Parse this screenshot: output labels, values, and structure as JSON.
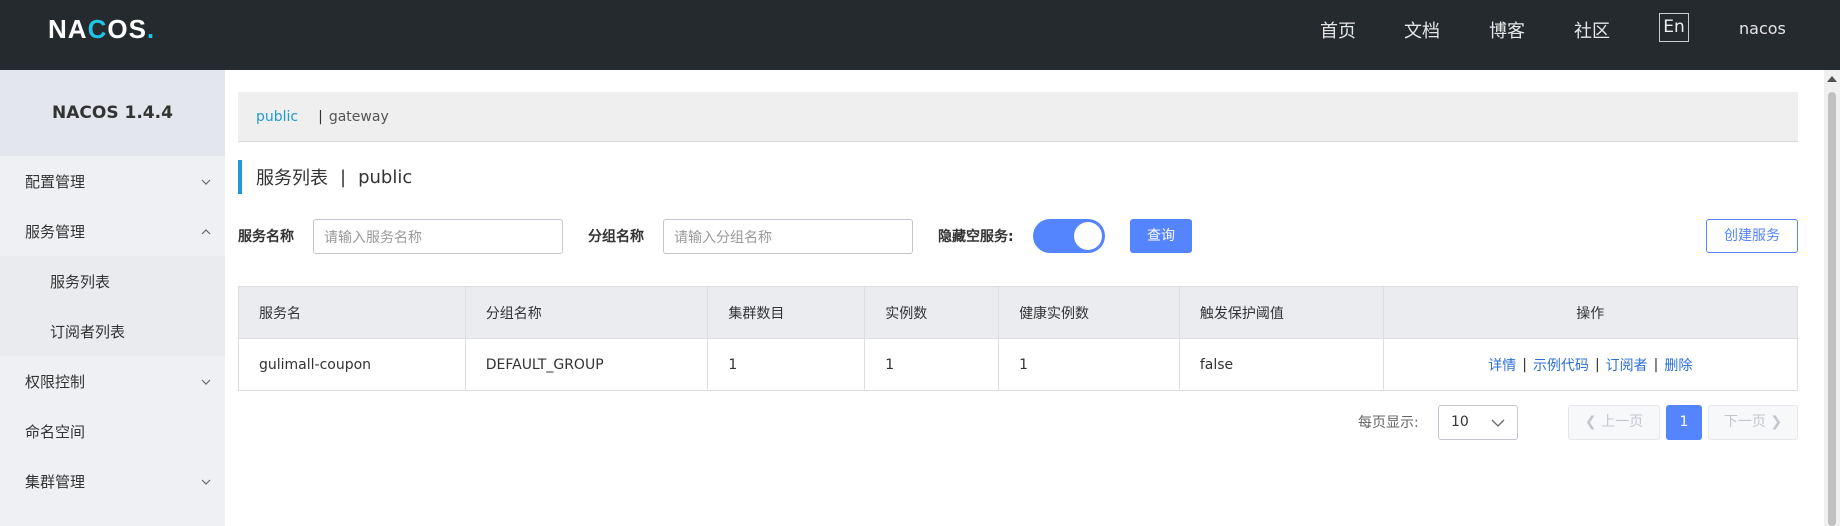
{
  "header": {
    "logo_left": "NA",
    "logo_mid": "C",
    "logo_right": "OS",
    "logo_dot": ".",
    "nav": [
      "首页",
      "文档",
      "博客",
      "社区"
    ],
    "lang_button": "En",
    "user": "nacos"
  },
  "sidebar": {
    "title": "NACOS 1.4.4",
    "items": [
      {
        "label": "配置管理",
        "chevron": "chevron-down"
      },
      {
        "label": "服务管理",
        "chevron": "chevron-up"
      },
      {
        "label": "服务列表",
        "sub": true
      },
      {
        "label": "订阅者列表",
        "sub": true
      },
      {
        "label": "权限控制",
        "chevron": "chevron-down"
      },
      {
        "label": "命名空间"
      },
      {
        "label": "集群管理",
        "chevron": "chevron-down"
      }
    ]
  },
  "namespace_bar": {
    "active": "public",
    "separator": "|",
    "other": "gateway"
  },
  "page": {
    "title": "服务列表",
    "separator": "|",
    "namespace": "public"
  },
  "filters": {
    "service_name_label": "服务名称",
    "service_name_placeholder": "请输入服务名称",
    "group_name_label": "分组名称",
    "group_name_placeholder": "请输入分组名称",
    "hide_empty_label": "隐藏空服务:",
    "hide_empty_on": true,
    "query_button": "查询",
    "create_button": "创建服务"
  },
  "table": {
    "columns": [
      "服务名",
      "分组名称",
      "集群数目",
      "实例数",
      "健康实例数",
      "触发保护阈值",
      "操作"
    ],
    "rows": [
      {
        "service": "gulimall-coupon",
        "group": "DEFAULT_GROUP",
        "clusters": "1",
        "instances": "1",
        "healthy": "1",
        "threshold": "false",
        "actions": [
          "详情",
          "示例代码",
          "订阅者",
          "删除"
        ]
      }
    ]
  },
  "pagination": {
    "per_page_label": "每页显示:",
    "per_page_value": "10",
    "prev": "上一页",
    "current": "1",
    "next": "下一页"
  },
  "colors": {
    "header_bg": "#252a2f",
    "accent_blue": "#5584ff",
    "logo_accent": "#1fc3e4",
    "namespace_active": "#1c9ad6"
  }
}
